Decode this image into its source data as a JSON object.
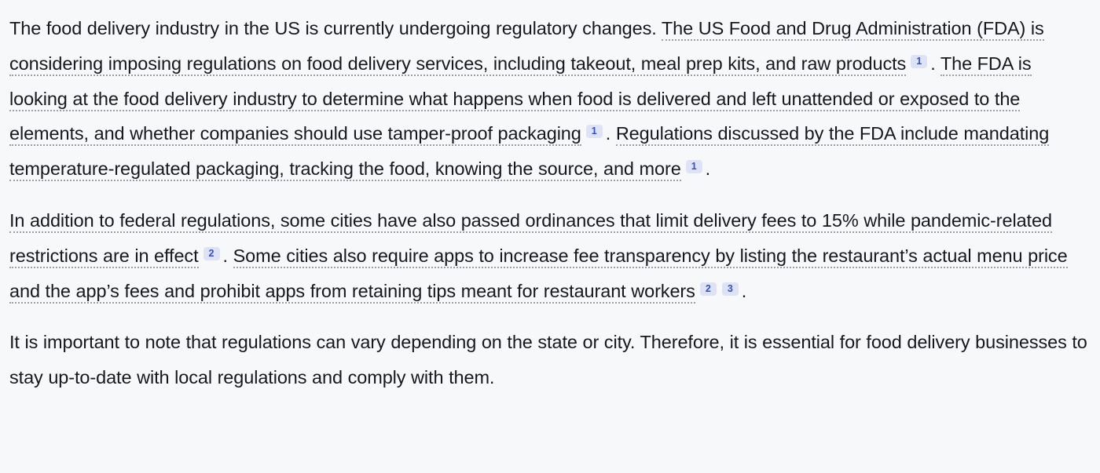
{
  "document": {
    "type": "chat-answer",
    "colors": {
      "background": "#f7f8fa",
      "text": "#16181d",
      "citation_badge_bg": "#dde2f7",
      "citation_badge_text": "#3550c4",
      "citation_underline": "#9aa0a8"
    },
    "paragraphs": [
      {
        "id": "p1",
        "segments": [
          {
            "type": "text",
            "value": "The food delivery industry in the US is currently undergoing regulatory changes. "
          },
          {
            "type": "cited",
            "value": "The US Food and Drug Administration (FDA) is considering imposing regulations on food delivery services, including takeout, meal prep kits, and raw products"
          },
          {
            "type": "badge",
            "value": "1"
          },
          {
            "type": "text",
            "value": ". "
          },
          {
            "type": "cited",
            "value": "The FDA is looking at the food delivery industry to determine what happens when food is delivered and left unattended or exposed to the elements, and whether companies should use tamper-proof packaging"
          },
          {
            "type": "badge",
            "value": "1"
          },
          {
            "type": "text",
            "value": ". "
          },
          {
            "type": "cited",
            "value": "Regulations discussed by the FDA include mandating temperature-regulated packaging, tracking the food, knowing the source, and more"
          },
          {
            "type": "badge",
            "value": "1"
          },
          {
            "type": "text",
            "value": "."
          }
        ]
      },
      {
        "id": "p2",
        "segments": [
          {
            "type": "cited",
            "value": "In addition to federal regulations, some cities have also passed ordinances that limit delivery fees to 15% while pandemic-related restrictions are in effect"
          },
          {
            "type": "badge",
            "value": "2"
          },
          {
            "type": "text",
            "value": ". "
          },
          {
            "type": "cited",
            "value": "Some cities also require apps to increase fee transparency by listing the restaurant’s actual menu price and the app’s fees and prohibit apps from retaining tips meant for restaurant workers"
          },
          {
            "type": "badge",
            "value": "2"
          },
          {
            "type": "badge",
            "value": "3"
          },
          {
            "type": "text",
            "value": "."
          }
        ]
      },
      {
        "id": "p3",
        "segments": [
          {
            "type": "text",
            "value": "It is important to note that regulations can vary depending on the state or city. Therefore, it is essential for food delivery businesses to stay up-to-date with local regulations and comply with them."
          }
        ]
      }
    ]
  }
}
